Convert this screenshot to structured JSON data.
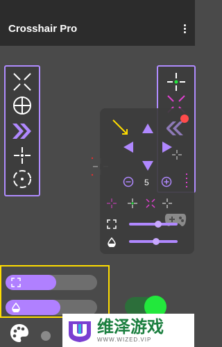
{
  "app": {
    "title": "Crosshair Pro"
  },
  "appbar": {
    "menu_icon": "more-vert-icon"
  },
  "left_panel": {
    "items": [
      "x-cross-icon",
      "scope-circle-icon",
      "chevron-double-right-icon",
      "dot-cross-icon",
      "circle-dotted-icon"
    ]
  },
  "right_panel": {
    "items": [
      "green-dot-cross-icon",
      "magenta-x-icon",
      "chevron-left-icon",
      "gray-cross-icon",
      "magenta-dotted-icon"
    ]
  },
  "overlay": {
    "stepper_value": "5",
    "minus_icon": "minus-circle-icon",
    "plus_icon": "plus-circle-icon",
    "size_slider_fraction": 0.6,
    "opacity_slider_fraction": 0.55
  },
  "bottom": {
    "size_bar_fraction": 0.55,
    "opacity_bar_fraction": 0.6
  },
  "watermark": {
    "title": "维泽游戏",
    "subtitle": "WWW.WIZED.VIP"
  },
  "colors": {
    "accent": "#b08cff",
    "yellow": "#ffdd00",
    "green": "#22e83c",
    "red": "#ff4b4b"
  }
}
